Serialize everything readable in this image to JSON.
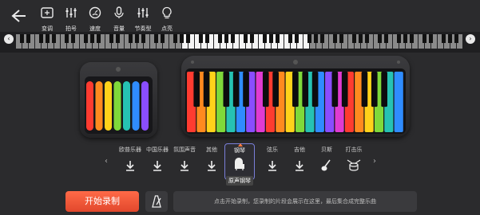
{
  "toolbar": {
    "tools": [
      {
        "label": "变调",
        "icon": "transpose-icon"
      },
      {
        "label": "拍号",
        "icon": "time-signature-icon"
      },
      {
        "label": "速度",
        "icon": "tempo-icon"
      },
      {
        "label": "音量",
        "icon": "volume-icon"
      },
      {
        "label": "节奏型",
        "icon": "rhythm-icon"
      },
      {
        "label": "点亮",
        "icon": "light-bulb-icon"
      }
    ]
  },
  "strip": {
    "left_arrow": "‹",
    "right_arrow": "›"
  },
  "instruments": {
    "prev": "‹",
    "next": "›",
    "items": [
      {
        "name": "欧普乐器",
        "icon": "download-icon"
      },
      {
        "name": "中国乐器",
        "icon": "download-icon"
      },
      {
        "name": "氛围声音",
        "icon": "download-icon"
      },
      {
        "name": "其他",
        "icon": "download-icon"
      },
      {
        "name": "钢琴",
        "icon": "piano-icon",
        "sub": "原声钢琴",
        "selected": true
      },
      {
        "name": "弦乐",
        "icon": "download-icon"
      },
      {
        "name": "吉他",
        "icon": "download-icon"
      },
      {
        "name": "贝斯",
        "icon": "bass-icon"
      },
      {
        "name": "打击乐",
        "icon": "drum-icon"
      }
    ]
  },
  "bottom": {
    "record_label": "开始录制",
    "hint": "点击开始录制，您录制的片段会展示在这里，最后集合成完整乐曲"
  },
  "colors": {
    "record": "#f0552f",
    "selected_border": "#7a7fd9",
    "rainbow": [
      "#ff3b30",
      "#ff8a1f",
      "#ffd21a",
      "#7fd93a",
      "#26c2b3",
      "#2f8cff",
      "#8a4dff",
      "#e03bd2"
    ]
  }
}
